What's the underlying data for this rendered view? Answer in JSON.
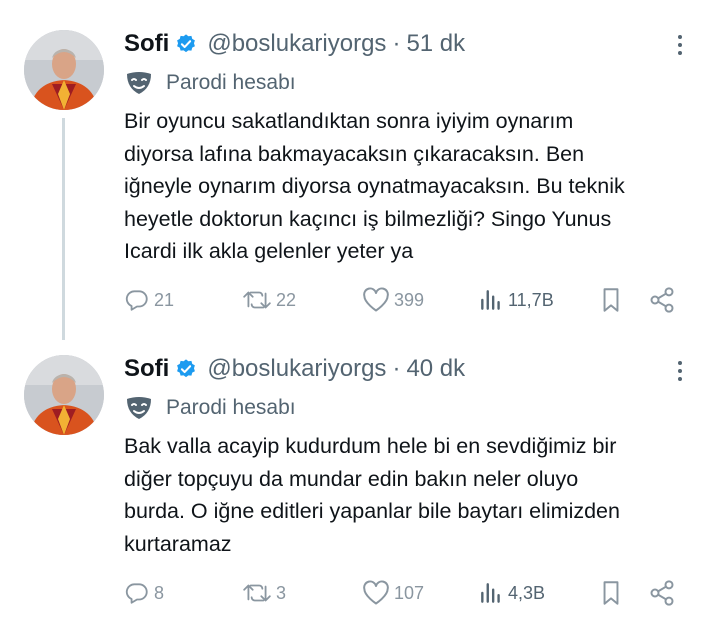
{
  "tweets": [
    {
      "author_name": "Sofi",
      "handle": "@boslukariyorgs",
      "separator": "·",
      "time": "51 dk",
      "label": "Parodi hesabı",
      "text": "Bir oyuncu sakatlandıktan sonra iyiyim oynarım\ndiyorsa lafına bakmayacaksın çıkaracaksın. Ben\niğneyle oynarım diyorsa oynatmayacaksın. Bu teknik\nheyetle doktorun kaçıncı iş bilmezliği? Singo Yunus\nIcardi ilk akla gelenler yeter ya",
      "replies": "21",
      "retweets": "22",
      "likes": "399",
      "views": "11,7B"
    },
    {
      "author_name": "Sofi",
      "handle": "@boslukariyorgs",
      "separator": "·",
      "time": "40 dk",
      "label": "Parodi hesabı",
      "text": "Bak valla acayip kudurdum hele bi en sevdiğimiz bir\ndiğer topçuyu da mundar edin bakın neler oluyo\nburda. O iğne editleri yapanlar bile baytarı elimizden\nkurtaramaz",
      "replies": "8",
      "retweets": "3",
      "likes": "107",
      "views": "4,3B"
    }
  ],
  "icons": {
    "verified": "verified-badge-icon",
    "parody": "parody-mask-icon",
    "more": "more-vertical-icon",
    "reply": "reply-icon",
    "retweet": "retweet-icon",
    "like": "heart-icon",
    "views": "views-chart-icon",
    "bookmark": "bookmark-icon",
    "share": "share-icon"
  },
  "colors": {
    "verified": "#1d9bf0",
    "text": "#0f1419",
    "secondary": "#536471",
    "thread_line": "#cfd9de"
  }
}
